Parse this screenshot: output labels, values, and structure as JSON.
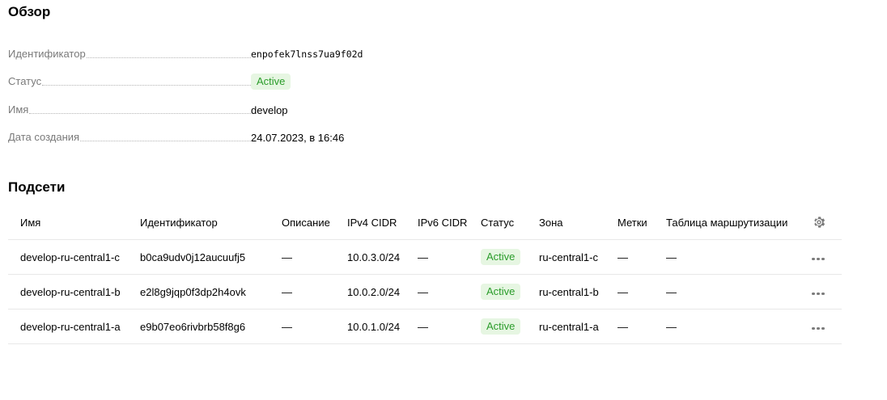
{
  "overview": {
    "title": "Обзор",
    "props": {
      "id": {
        "label": "Идентификатор",
        "value": "enpofek7lnss7ua9f02d"
      },
      "status": {
        "label": "Статус",
        "value": "Active"
      },
      "name": {
        "label": "Имя",
        "value": "develop"
      },
      "created": {
        "label": "Дата создания",
        "value": "24.07.2023, в 16:46"
      }
    }
  },
  "subnets": {
    "title": "Подсети",
    "columns": {
      "name": "Имя",
      "id": "Идентификатор",
      "description": "Описание",
      "ipv4": "IPv4 CIDR",
      "ipv6": "IPv6 CIDR",
      "status": "Статус",
      "zone": "Зона",
      "labels": "Метки",
      "route_table": "Таблица маршрутизации"
    },
    "settings_icon": "gear-icon",
    "more_icon": "more-horizontal-icon",
    "rows": [
      {
        "name": "develop-ru-central1-c",
        "id": "b0ca9udv0j12aucuufj5",
        "description": "—",
        "ipv4": "10.0.3.0/24",
        "ipv6": "—",
        "status": "Active",
        "zone": "ru-central1-c",
        "labels": "—",
        "route_table": "—"
      },
      {
        "name": "develop-ru-central1-b",
        "id": "e2l8g9jqp0f3dp2h4ovk",
        "description": "—",
        "ipv4": "10.0.2.0/24",
        "ipv6": "—",
        "status": "Active",
        "zone": "ru-central1-b",
        "labels": "—",
        "route_table": "—"
      },
      {
        "name": "develop-ru-central1-a",
        "id": "e9b07eo6rivbrb58f8g6",
        "description": "—",
        "ipv4": "10.0.1.0/24",
        "ipv6": "—",
        "status": "Active",
        "zone": "ru-central1-a",
        "labels": "—",
        "route_table": "—"
      }
    ]
  },
  "colors": {
    "status_active_bg": "#e6f6e2",
    "status_active_text": "#2a9c2a",
    "muted_text": "#7a7a7a",
    "divider": "#e8e8e8"
  }
}
